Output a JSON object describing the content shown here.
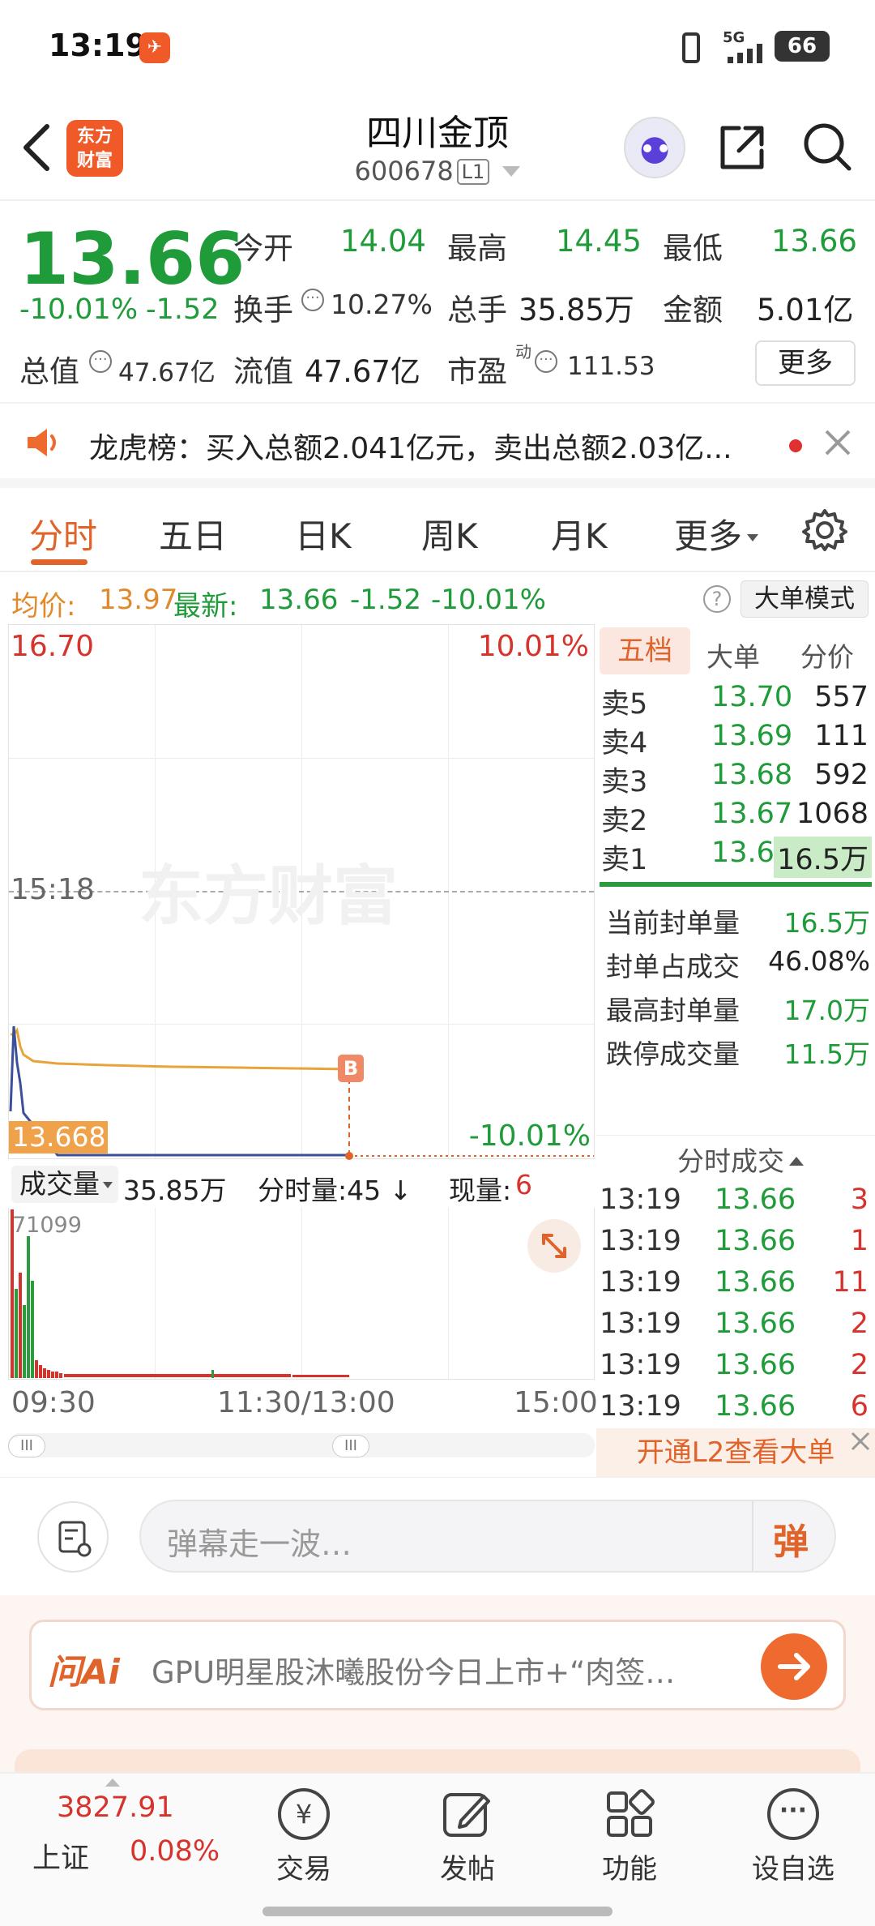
{
  "status_bar": {
    "time": "13:19",
    "network": "5G",
    "battery": "66"
  },
  "header": {
    "brand_logo": "东方\n财富",
    "stock_name": "四川金顶",
    "stock_code": "600678",
    "level": "L1"
  },
  "quote": {
    "price": "13.66",
    "change_pct": "-10.01%",
    "change": "-1.52",
    "open_label": "今开",
    "open": "14.04",
    "high_label": "最高",
    "high": "14.45",
    "low_label": "最低",
    "low": "13.66",
    "turnover_label": "换手",
    "turnover": "10.27%",
    "volume_label": "总手",
    "volume": "35.85万",
    "amount_label": "金额",
    "amount": "5.01亿",
    "mktcap_label": "总值",
    "mktcap": "47.67亿",
    "float_label": "流值",
    "float": "47.67亿",
    "pe_label": "市盈",
    "pe_sup": "动",
    "pe": "111.53",
    "more": "更多"
  },
  "notice": {
    "text": "龙虎榜：买入总额2.041亿元，卖出总额2.03亿..."
  },
  "tabs": [
    "分时",
    "五日",
    "日K",
    "周K",
    "月K",
    "更多"
  ],
  "info_line": {
    "avg_label": "均价:",
    "avg": "13.97",
    "latest_label": "最新:",
    "latest": "13.66",
    "chg": "-1.52",
    "pct": "-10.01%",
    "mode_button": "大单模式"
  },
  "chart": {
    "top_price": "16.70",
    "top_pct": "10.01%",
    "mid_time": "15:18",
    "current_tag": "13.668",
    "bottom_pct": "-10.01%",
    "marker": "B",
    "watermark": "东方财富",
    "vol_label": "成交量",
    "vol_value": "35.85万",
    "period_label": "分时量:45",
    "period_arrow": "↓",
    "now_label": "现量:",
    "now_value": "6",
    "vol_max": "71099",
    "time_axis": [
      "09:30",
      "11:30/13:00",
      "15:00"
    ]
  },
  "order_book": {
    "tabs": [
      "五档",
      "大单",
      "分价"
    ],
    "asks": [
      {
        "label": "卖5",
        "price": "13.70",
        "vol": "557"
      },
      {
        "label": "卖4",
        "price": "13.69",
        "vol": "111"
      },
      {
        "label": "卖3",
        "price": "13.68",
        "vol": "592"
      },
      {
        "label": "卖2",
        "price": "13.67",
        "vol": "1068"
      },
      {
        "label": "卖1",
        "price": "13.66",
        "vol": "16.5万"
      }
    ],
    "stats": [
      {
        "label": "当前封单量",
        "value": "16.5万"
      },
      {
        "label": "封单占成交",
        "value": "46.08%"
      },
      {
        "label": "最高封单量",
        "value": "17.0万"
      },
      {
        "label": "跌停成交量",
        "value": "11.5万"
      }
    ],
    "ticks_title": "分时成交",
    "ticks": [
      {
        "time": "13:19",
        "price": "13.66",
        "vol": "3"
      },
      {
        "time": "13:19",
        "price": "13.66",
        "vol": "1"
      },
      {
        "time": "13:19",
        "price": "13.66",
        "vol": "11"
      },
      {
        "time": "13:19",
        "price": "13.66",
        "vol": "2"
      },
      {
        "time": "13:19",
        "price": "13.66",
        "vol": "2"
      },
      {
        "time": "13:19",
        "price": "13.66",
        "vol": "6"
      }
    ],
    "l2_banner": "开通L2查看大单"
  },
  "danmaku": {
    "placeholder": "弹幕走一波…",
    "button": "弹"
  },
  "ai_banner": {
    "logo": "问Ai",
    "text": "GPU明星股沐曦股份今日上市+“肉签…"
  },
  "bottom_nav": {
    "index_value": "3827.91",
    "index_name": "上证",
    "index_pct": "0.08%",
    "items": [
      "交易",
      "发帖",
      "功能",
      "设自选"
    ]
  }
}
